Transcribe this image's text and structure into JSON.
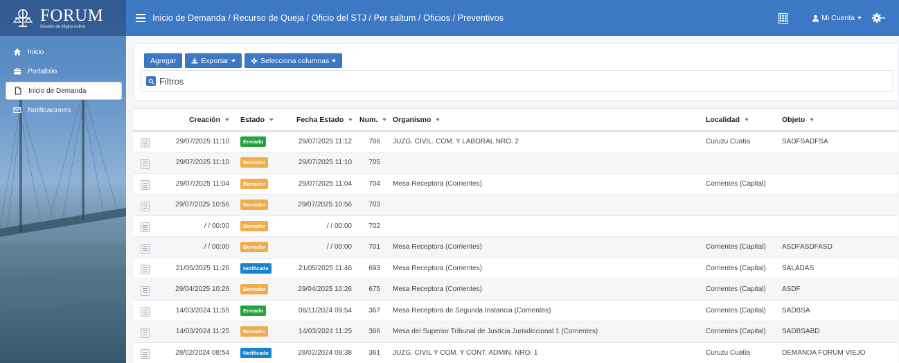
{
  "brand": {
    "name": "FORUM",
    "subtitle": "Gestión de litigios online"
  },
  "breadcrumb": "Inicio de Demanda / Recurso de Queja / Oficio del STJ / Per saltum / Oficios / Preventivos",
  "account": {
    "label": "Mi Cuenta"
  },
  "sidebar": {
    "items": [
      {
        "label": "Inicio",
        "icon": "home-icon",
        "active": false
      },
      {
        "label": "Portafolio",
        "icon": "briefcase-icon",
        "active": false
      },
      {
        "label": "Inicio de Demanda",
        "icon": "file-icon",
        "active": true
      },
      {
        "label": "Notificaciones",
        "icon": "envelope-icon",
        "active": false
      }
    ]
  },
  "toolbar": {
    "add_label": "Agregar",
    "export_label": "Exportar",
    "columns_label": "Selecciona columnas",
    "filters_label": "Filtros"
  },
  "table": {
    "columns": [
      "Creación",
      "Estado",
      "Fecha Estado",
      "Num.",
      "Organismo",
      "Localidad",
      "Objeto"
    ],
    "rows": [
      {
        "creacion": "29/07/2025 11:10",
        "estado": "Enviado",
        "fecha_estado": "29/07/2025 11:12",
        "num": "706",
        "organismo": "JUZG. CIVIL. COM. Y LABORAL NRO. 2",
        "localidad": "Curuzu Cuatia",
        "objeto": "SADFSADFSA"
      },
      {
        "creacion": "29/07/2025 11:10",
        "estado": "Borrador",
        "fecha_estado": "29/07/2025 11:10",
        "num": "705",
        "organismo": "",
        "localidad": "",
        "objeto": ""
      },
      {
        "creacion": "29/07/2025 11:04",
        "estado": "Borrador",
        "fecha_estado": "29/07/2025 11:04",
        "num": "704",
        "organismo": "Mesa Receptora (Corrientes)",
        "localidad": "Corrientes (Capital)",
        "objeto": ""
      },
      {
        "creacion": "29/07/2025 10:56",
        "estado": "Borrador",
        "fecha_estado": "29/07/2025 10:56",
        "num": "703",
        "organismo": "",
        "localidad": "",
        "objeto": ""
      },
      {
        "creacion": "/ / 00:00",
        "estado": "Borrador",
        "fecha_estado": "/ / 00:00",
        "num": "702",
        "organismo": "",
        "localidad": "",
        "objeto": ""
      },
      {
        "creacion": "/ / 00:00",
        "estado": "Borrador",
        "fecha_estado": "/ / 00:00",
        "num": "701",
        "organismo": "Mesa Receptora (Corrientes)",
        "localidad": "Corrientes (Capital)",
        "objeto": "ASDFASDFASD"
      },
      {
        "creacion": "21/05/2025 11:26",
        "estado": "Notificado",
        "fecha_estado": "21/05/2025 11:46",
        "num": "693",
        "organismo": "Mesa Receptora (Corrientes)",
        "localidad": "Corrientes (Capital)",
        "objeto": "SALADAS"
      },
      {
        "creacion": "29/04/2025 10:26",
        "estado": "Borrador",
        "fecha_estado": "29/04/2025 10:26",
        "num": "675",
        "organismo": "Mesa Receptora (Corrientes)",
        "localidad": "Corrientes (Capital)",
        "objeto": "ASDF"
      },
      {
        "creacion": "14/03/2024 11:55",
        "estado": "Enviado",
        "fecha_estado": "08/11/2024 09:54",
        "num": "367",
        "organismo": "Mesa Receptora de Segunda Instancia (Corrientes)",
        "localidad": "Corrientes (Capital)",
        "objeto": "SADBSA"
      },
      {
        "creacion": "14/03/2024 11:25",
        "estado": "Borrador",
        "fecha_estado": "14/03/2024 11:25",
        "num": "366",
        "organismo": "Mesa del Superior Tribunal de Justicia Jurisdiccional 1 (Corrientes)",
        "localidad": "Corrientes (Capital)",
        "objeto": "SADBSABD"
      },
      {
        "creacion": "28/02/2024 08:54",
        "estado": "Notificado",
        "fecha_estado": "28/02/2024 09:38",
        "num": "361",
        "organismo": "JUZG. CIVIL Y COM. Y CONT. ADMIN. NRO. 1",
        "localidad": "Curuzu Cuatia",
        "objeto": "DEMANDA FORUM VIEJO"
      }
    ]
  },
  "colors": {
    "primary": "#3c78c4",
    "enviado": "#27a243",
    "borrador": "#f0ad4e",
    "notificado": "#1b83c9"
  }
}
